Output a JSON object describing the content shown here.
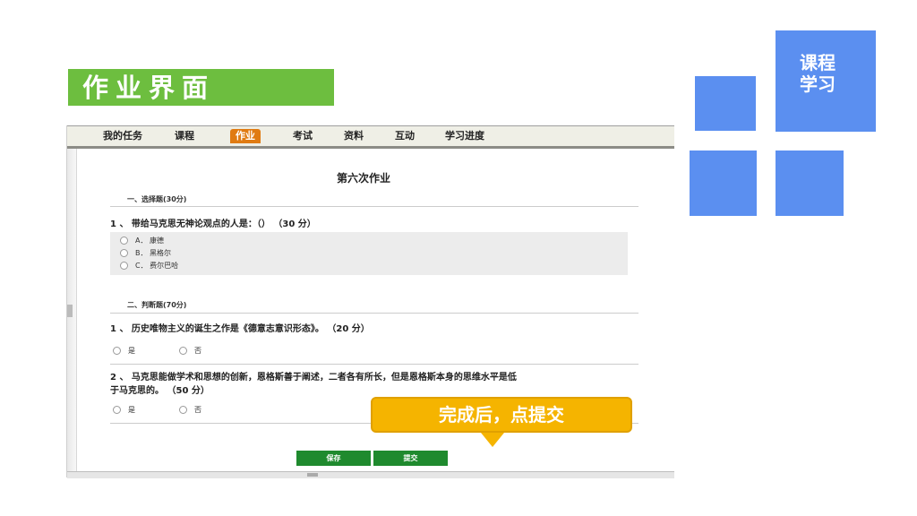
{
  "page_title": "作业界面",
  "side_label": {
    "line1": "课程",
    "line2": "学习"
  },
  "nav": {
    "items": [
      "我的任务",
      "课程",
      "作业",
      "考试",
      "资料",
      "互动",
      "学习进度"
    ],
    "active": "作业"
  },
  "homework": {
    "title": "第六次作业",
    "section1": "一、选择题(30分)",
    "q1": "1 、 带给马克思无神论观点的人是：（）  （30 分）",
    "q1_options": [
      "A． 康德",
      "B． 黑格尔",
      "C． 费尔巴哈"
    ],
    "section2": "二、判断题(70分)",
    "q2": "1 、 历史唯物主义的诞生之作是《德意志意识形态》。  （20 分）",
    "q2_options": [
      "是",
      "否"
    ],
    "q3_line1": "2 、 马克思能做学术和思想的创新，恩格斯善于阐述，二者各有所长，但是恩格斯本身的思维水平是低",
    "q3_line2": "于马克思的。 （50 分）",
    "q3_options": [
      "是",
      "否"
    ],
    "save_label": "保存",
    "submit_label": "提交"
  },
  "callout": "完成后，点提交",
  "colors": {
    "accent_green": "#6dbe3f",
    "tile_blue": "#5b8ff0",
    "callout_yellow": "#f5b400",
    "tab_orange": "#e07b12",
    "button_green": "#1f8a2e"
  }
}
